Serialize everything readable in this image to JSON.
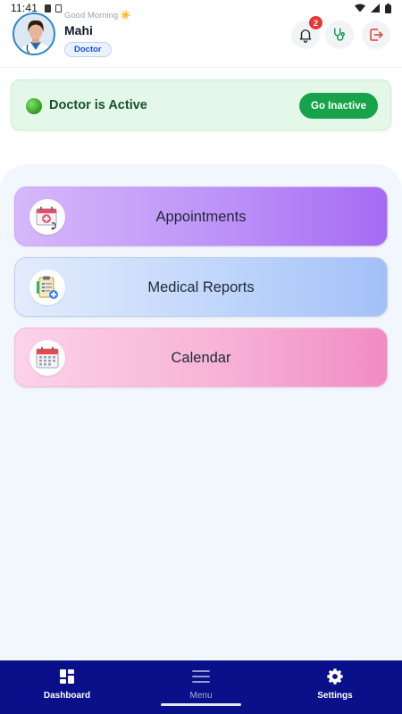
{
  "status_bar": {
    "time": "11:41"
  },
  "header": {
    "greeting": "Good Morning",
    "greeting_emoji": "☀️",
    "user_name": "Mahi",
    "role": "Doctor",
    "notification_count": "2",
    "icons": [
      "bell-icon",
      "stethoscope-icon",
      "logout-icon"
    ]
  },
  "status_card": {
    "text": "Doctor is Active",
    "button_label": "Go Inactive",
    "status_color": "#2e9d1a",
    "button_color": "#16a34a"
  },
  "menu": {
    "items": [
      {
        "label": "Appointments",
        "icon": "appointment-icon"
      },
      {
        "label": "Medical Reports",
        "icon": "medical-report-icon"
      },
      {
        "label": "Calendar",
        "icon": "calendar-icon"
      }
    ]
  },
  "bottom_nav": {
    "items": [
      {
        "label": "Dashboard",
        "icon": "dashboard-icon"
      },
      {
        "label": "Menu",
        "icon": "hamburger-icon"
      },
      {
        "label": "Settings",
        "icon": "gear-icon"
      }
    ],
    "background": "#0a0f8a"
  }
}
